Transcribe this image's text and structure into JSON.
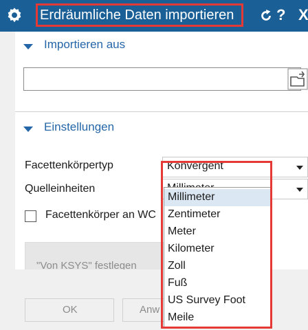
{
  "titlebar": {
    "title": "Erdräumliche Daten importieren",
    "help_symbol": "?",
    "close_symbol": "X"
  },
  "import_section": {
    "title": "Importieren aus",
    "path_value": ""
  },
  "settings_section": {
    "title": "Einstellungen",
    "facet_type_label": "Facettenkörpertyp",
    "facet_type_value": "Konvergent",
    "source_units_label": "Quelleinheiten",
    "source_units_value": "Millimeter",
    "checkbox_label": "Facettenkörper an WC",
    "checkbox_checked": false,
    "ksys_button": "\"Von KSYS\" festlegen"
  },
  "footer": {
    "ok_label": "OK",
    "apply_label": "Anw"
  },
  "units_dropdown": {
    "options": [
      "Millimeter",
      "Zentimeter",
      "Meter",
      "Kilometer",
      "Zoll",
      "Fuß",
      "US Survey Foot",
      "Meile"
    ],
    "selected": "Millimeter"
  },
  "colors": {
    "titlebar_bg": "#1a5f96",
    "section_accent": "#2566a8",
    "highlight": "#e53935",
    "selected_option_bg": "#dbe8f4"
  },
  "icons": [
    "gear-icon",
    "reset-icon",
    "help-icon",
    "close-icon",
    "collapse-arrow-icon",
    "file-open-icon",
    "dropdown-arrow-icon"
  ]
}
